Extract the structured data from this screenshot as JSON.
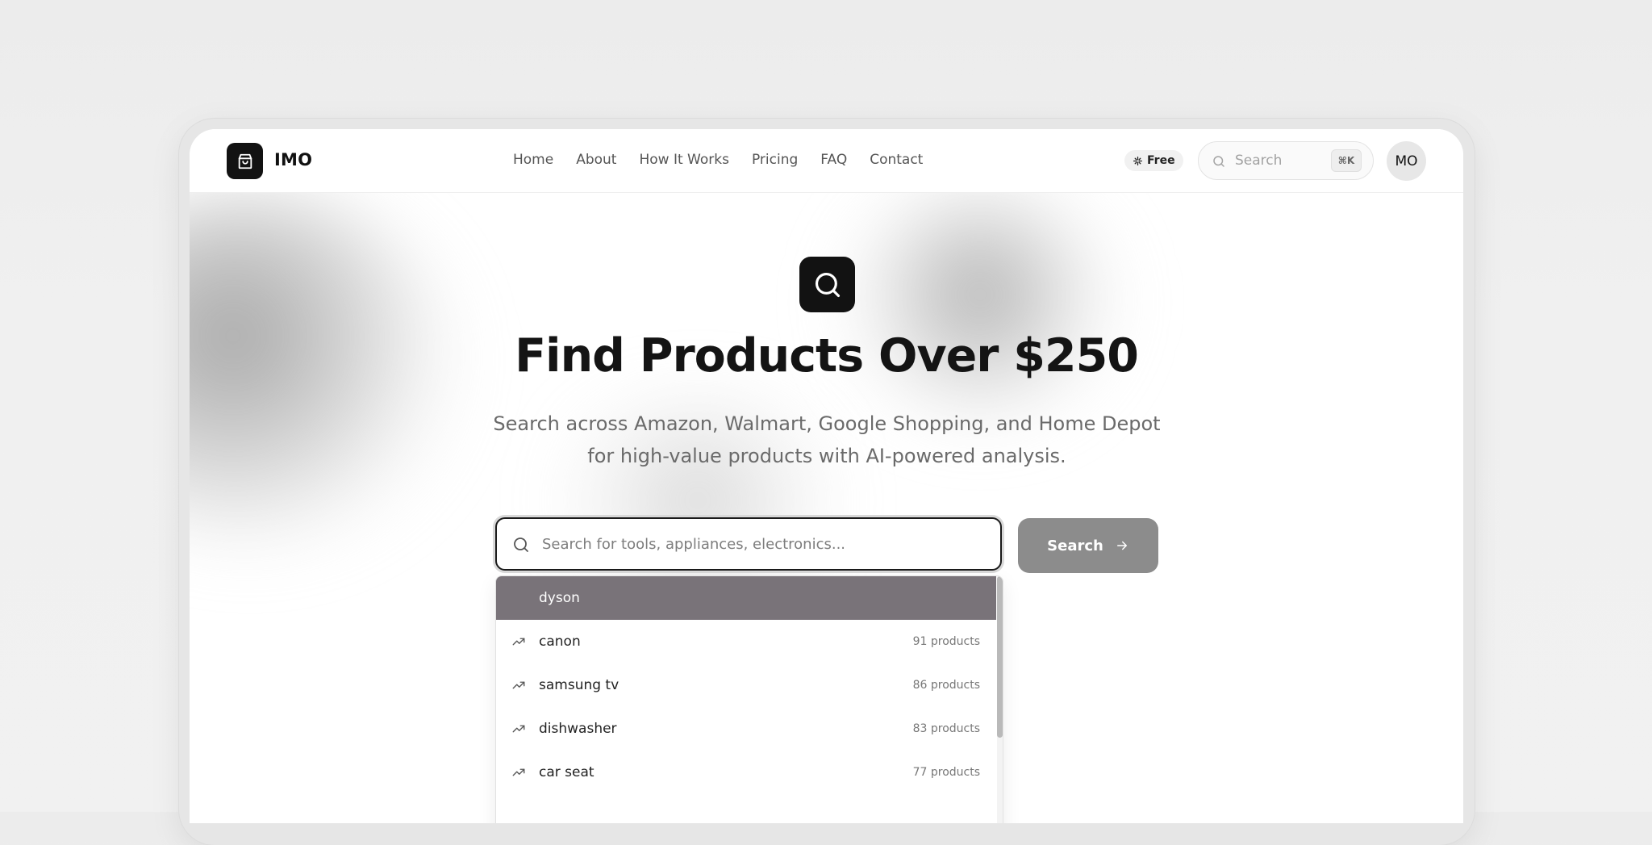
{
  "brand": {
    "name": "IMO",
    "logo_icon": "shopping-bag-icon"
  },
  "nav": {
    "links": [
      "Home",
      "About",
      "How It Works",
      "Pricing",
      "FAQ",
      "Contact"
    ],
    "free_badge": "Free",
    "free_badge_icon": "sparkle-icon",
    "search_placeholder": "Search",
    "search_shortcut": "⌘K",
    "avatar_initials": "MO"
  },
  "hero": {
    "icon": "search-icon",
    "title": "Find Products Over $250",
    "subtitle": "Search across Amazon, Walmart, Google Shopping, and Home Depot for high-value products with AI-powered analysis."
  },
  "search": {
    "placeholder": "Search for tools, appliances, electronics...",
    "value": "",
    "button_label": "Search",
    "button_icon": "arrow-right-icon"
  },
  "suggestions": {
    "active_index": 0,
    "items": [
      {
        "label": "dyson",
        "count": ""
      },
      {
        "label": "canon",
        "count": "91 products"
      },
      {
        "label": "samsung tv",
        "count": "86 products"
      },
      {
        "label": "dishwasher",
        "count": "83 products"
      },
      {
        "label": "car seat",
        "count": "77 products"
      }
    ],
    "trend_icon": "trending-up-icon"
  },
  "colors": {
    "brand_dark": "#121212",
    "search_button": "#8c8c8c",
    "active_suggestion": "#797379",
    "page_background": "#efefef"
  }
}
